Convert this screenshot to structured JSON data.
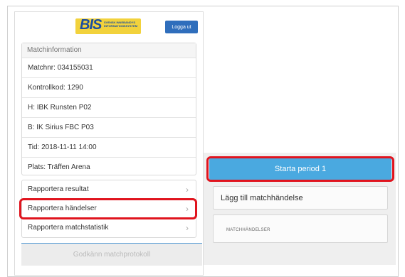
{
  "header": {
    "logo_text": "BIS",
    "logo_tagline": "SVENSK INNEBANDYS INFORMATIONSSYSTEM",
    "logout_label": "Logga ut"
  },
  "match_info": {
    "title": "Matchinformation",
    "rows": [
      "Matchnr: 034155031",
      "Kontrollkod: 1290",
      "H: IBK Runsten P02",
      "B: IK Sirius FBC P03",
      "Tid: 2018-11-11 14:00",
      "Plats: Träffen Arena"
    ]
  },
  "menu": {
    "items": [
      {
        "label": "Rapportera resultat",
        "highlighted": false
      },
      {
        "label": "Rapportera händelser",
        "highlighted": true
      },
      {
        "label": "Rapportera matchstatistik",
        "highlighted": false
      }
    ],
    "chevron_icon": "chevron-right-icon"
  },
  "approve_button": {
    "label": "Godkänn matchprotokoll"
  },
  "right": {
    "start_period_label": "Starta period 1",
    "add_event_label": "Lägg till matchhändelse",
    "events_heading": "MATCHHÄNDELSER"
  },
  "colors": {
    "highlight": "#e0141e",
    "primary": "#4aa9e0",
    "logout": "#2f6ebc",
    "logo_bg": "#f2d23c"
  }
}
